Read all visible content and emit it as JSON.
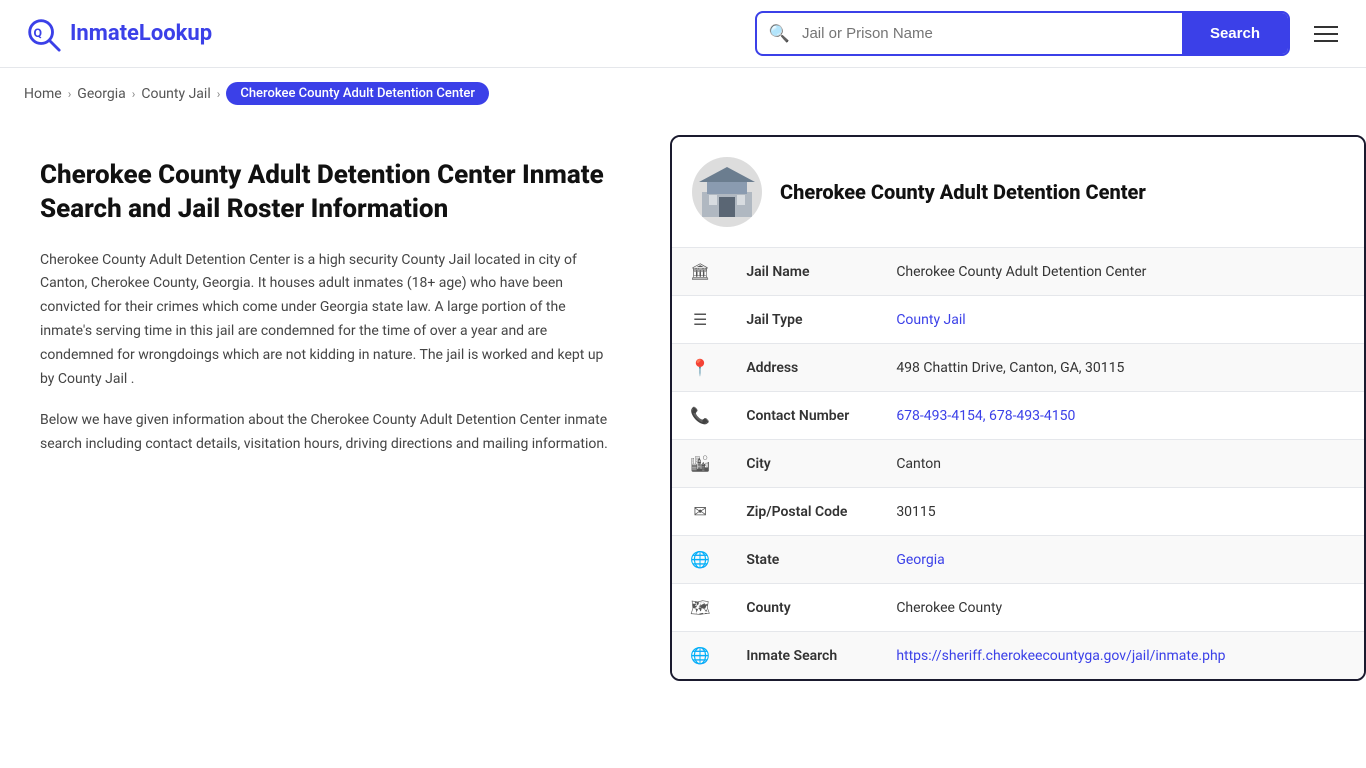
{
  "header": {
    "logo_text_part1": "Inmate",
    "logo_text_part2": "Lookup",
    "search_placeholder": "Jail or Prison Name",
    "search_button_label": "Search"
  },
  "breadcrumb": {
    "items": [
      {
        "label": "Home",
        "href": "#"
      },
      {
        "label": "Georgia",
        "href": "#"
      },
      {
        "label": "County Jail",
        "href": "#"
      },
      {
        "label": "Cherokee County Adult Detention Center",
        "current": true
      }
    ]
  },
  "left": {
    "page_title": "Cherokee County Adult Detention Center Inmate Search and Jail Roster Information",
    "desc1": "Cherokee County Adult Detention Center is a high security County Jail located in city of Canton, Cherokee County, Georgia. It houses adult inmates (18+ age) who have been convicted for their crimes which come under Georgia state law. A large portion of the inmate's serving time in this jail are condemned for the time of over a year and are condemned for wrongdoings which are not kidding in nature. The jail is worked and kept up by County Jail .",
    "desc2": "Below we have given information about the Cherokee County Adult Detention Center inmate search including contact details, visitation hours, driving directions and mailing information."
  },
  "card": {
    "title": "Cherokee County Adult Detention Center",
    "rows": [
      {
        "icon": "🏛",
        "label": "Jail Name",
        "value": "Cherokee County Adult Detention Center",
        "link": null
      },
      {
        "icon": "☰",
        "label": "Jail Type",
        "value": "County Jail",
        "link": "#"
      },
      {
        "icon": "📍",
        "label": "Address",
        "value": "498 Chattin Drive, Canton, GA, 30115",
        "link": null
      },
      {
        "icon": "📞",
        "label": "Contact Number",
        "value": "678-493-4154, 678-493-4150",
        "link": "#"
      },
      {
        "icon": "🏙",
        "label": "City",
        "value": "Canton",
        "link": null
      },
      {
        "icon": "✉",
        "label": "Zip/Postal Code",
        "value": "30115",
        "link": null
      },
      {
        "icon": "🌐",
        "label": "State",
        "value": "Georgia",
        "link": "#"
      },
      {
        "icon": "🗺",
        "label": "County",
        "value": "Cherokee County",
        "link": null
      },
      {
        "icon": "🌐",
        "label": "Inmate Search",
        "value": "https://sheriff.cherokeecountyga.gov/jail/inmate.php",
        "link": "https://sheriff.cherokeecountyga.gov/jail/inmate.php"
      }
    ]
  },
  "colors": {
    "accent": "#3b40e8",
    "dark": "#1a1a2e"
  }
}
